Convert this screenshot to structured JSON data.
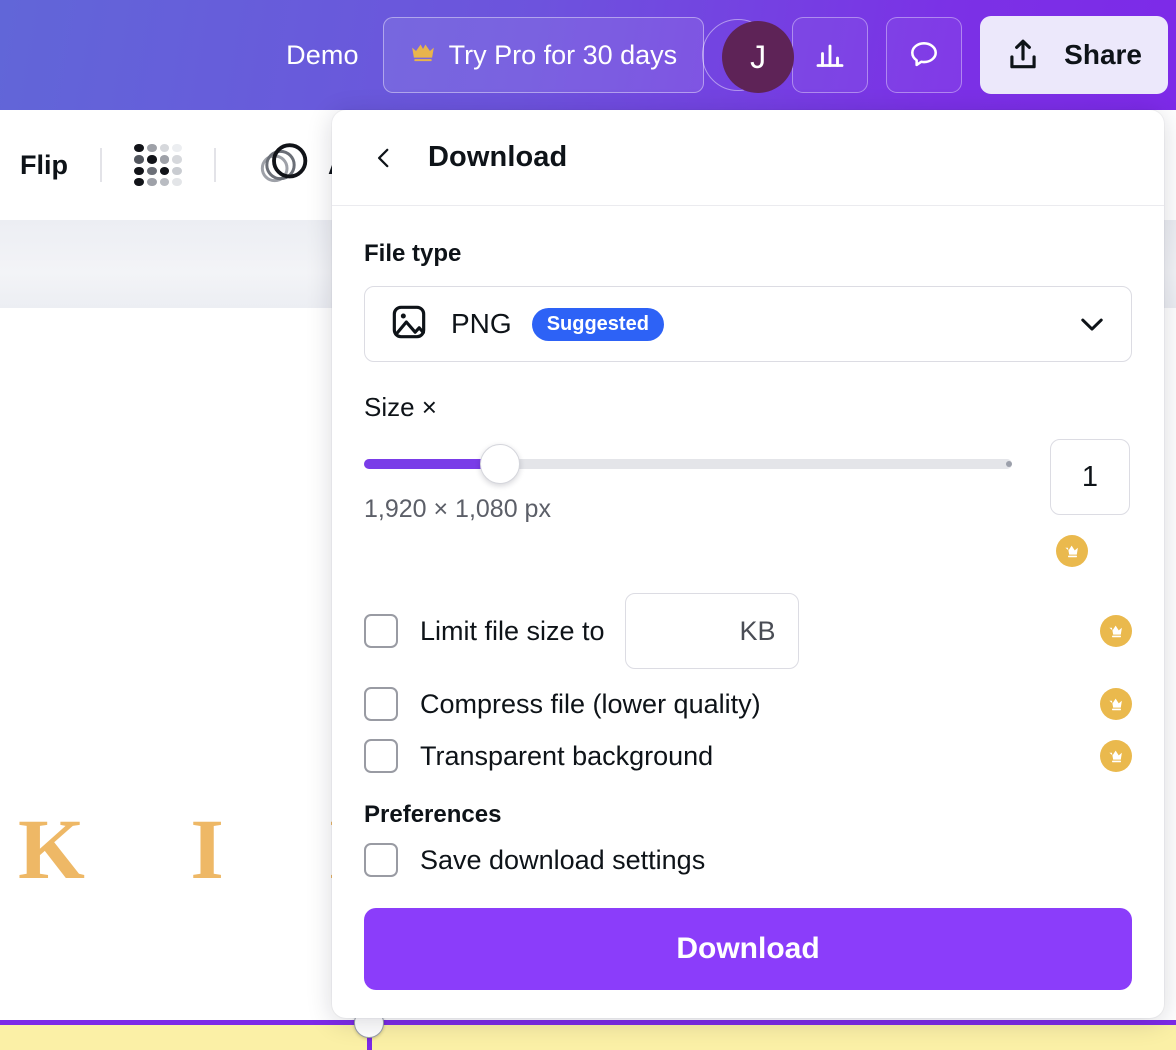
{
  "topbar": {
    "demo_label": "Demo",
    "try_pro_label": "Try Pro for 30 days",
    "try_pro_icon": "crown-icon",
    "avatar_initial": "J",
    "add_collaborator_icon": "plus-icon",
    "insights_icon": "bar-chart-icon",
    "comments_icon": "comment-bubble-icon",
    "share_label": "Share",
    "share_icon": "upload-share-icon",
    "gradient_start": "#6166d8",
    "gradient_end": "#7d2ae8",
    "avatar_bg": "#5e2357"
  },
  "toolbar": {
    "flip_label": "Flip",
    "transparency_icon": "checkerboard-transparency-icon",
    "animate_label": "Anim",
    "animate_icon": "animate-circles-icon"
  },
  "canvas": {
    "heading_text": "K I N",
    "heading_color": "#eeb866",
    "selection_color": "#7d2ae8",
    "band_color": "#fbf0a6"
  },
  "panel": {
    "back_icon": "chevron-left-icon",
    "title": "Download",
    "file_type": {
      "section_label": "File type",
      "icon": "image-file-icon",
      "value": "PNG",
      "badge": "Suggested",
      "badge_color": "#2d62f6",
      "chevron_icon": "chevron-down-icon"
    },
    "size": {
      "label": "Size ×",
      "value": "1",
      "dimensions": "1,920 × 1,080 px",
      "slider_percent": 21,
      "slider_fill_color": "#7a3ce8",
      "slider_track_color": "#e4e5e9",
      "tick_percent": 99,
      "pro_badge_icon": "crown-badge-icon"
    },
    "options": [
      {
        "label": "Limit file size to",
        "checked": false,
        "input_unit": "KB",
        "input_value": "",
        "pro": true,
        "pro_badge_icon": "crown-badge-icon"
      },
      {
        "label": "Compress file (lower quality)",
        "checked": false,
        "pro": true,
        "pro_badge_icon": "crown-badge-icon"
      },
      {
        "label": "Transparent background",
        "checked": false,
        "pro": true,
        "pro_badge_icon": "crown-badge-icon"
      }
    ],
    "preferences": {
      "section_label": "Preferences",
      "save_settings_label": "Save download settings",
      "save_settings_checked": false
    },
    "download_button_label": "Download",
    "download_button_color": "#8b3dfa",
    "pro_badge_color": "#eab94d"
  }
}
